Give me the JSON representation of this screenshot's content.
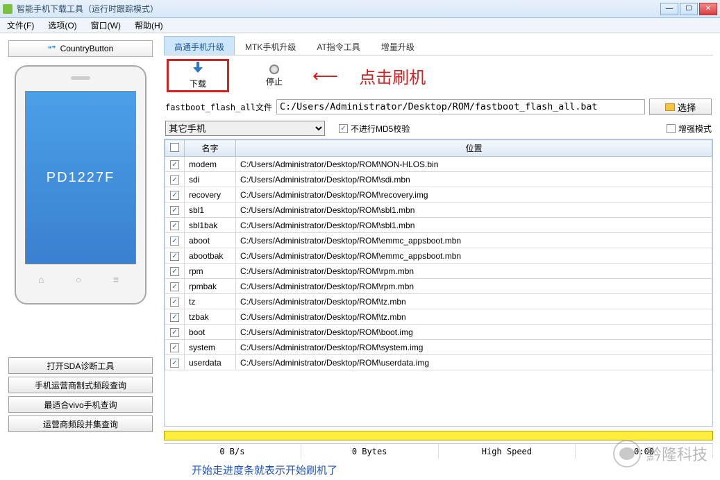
{
  "window": {
    "title": "智能手机下载工具（运行时跟踪模式）"
  },
  "menu": {
    "file": "文件(F)",
    "options": "选项(O)",
    "window": "窗口(W)",
    "help": "帮助(H)"
  },
  "sidebar": {
    "country_button": "CountryButton",
    "phone_model": "PD1227F",
    "buttons": {
      "sda": "打开SDA诊断工具",
      "carrier_band": "手机运营商制式频段查询",
      "vivo_query": "最适合vivo手机查询",
      "band_collect": "运营商频段并集查询"
    }
  },
  "tabs": {
    "qualcomm": "高通手机升级",
    "mtk": "MTK手机升级",
    "at": "AT指令工具",
    "incremental": "增量升级"
  },
  "toolbar": {
    "download": "下载",
    "stop": "停止"
  },
  "annotation": {
    "arrow": "⬅",
    "text": "点击刷机"
  },
  "file_row": {
    "label": "fastboot_flash_all文件",
    "path": "C:/Users/Administrator/Desktop/ROM/fastboot_flash_all.bat",
    "choose": "选择"
  },
  "opts": {
    "phone_type": "其它手机",
    "skip_md5": "不进行MD5校验",
    "enhanced": "增强模式"
  },
  "table": {
    "headers": {
      "name": "名字",
      "location": "位置"
    },
    "rows": [
      {
        "checked": true,
        "name": "modem",
        "location": "C:/Users/Administrator/Desktop/ROM\\NON-HLOS.bin"
      },
      {
        "checked": true,
        "name": "sdi",
        "location": "C:/Users/Administrator/Desktop/ROM\\sdi.mbn"
      },
      {
        "checked": true,
        "name": "recovery",
        "location": "C:/Users/Administrator/Desktop/ROM\\recovery.img"
      },
      {
        "checked": true,
        "name": "sbl1",
        "location": "C:/Users/Administrator/Desktop/ROM\\sbl1.mbn"
      },
      {
        "checked": true,
        "name": "sbl1bak",
        "location": "C:/Users/Administrator/Desktop/ROM\\sbl1.mbn"
      },
      {
        "checked": true,
        "name": "aboot",
        "location": "C:/Users/Administrator/Desktop/ROM\\emmc_appsboot.mbn"
      },
      {
        "checked": true,
        "name": "abootbak",
        "location": "C:/Users/Administrator/Desktop/ROM\\emmc_appsboot.mbn"
      },
      {
        "checked": true,
        "name": "rpm",
        "location": "C:/Users/Administrator/Desktop/ROM\\rpm.mbn"
      },
      {
        "checked": true,
        "name": "rpmbak",
        "location": "C:/Users/Administrator/Desktop/ROM\\rpm.mbn"
      },
      {
        "checked": true,
        "name": "tz",
        "location": "C:/Users/Administrator/Desktop/ROM\\tz.mbn"
      },
      {
        "checked": true,
        "name": "tzbak",
        "location": "C:/Users/Administrator/Desktop/ROM\\tz.mbn"
      },
      {
        "checked": true,
        "name": "boot",
        "location": "C:/Users/Administrator/Desktop/ROM\\boot.img"
      },
      {
        "checked": true,
        "name": "system",
        "location": "C:/Users/Administrator/Desktop/ROM\\system.img"
      },
      {
        "checked": true,
        "name": "userdata",
        "location": "C:/Users/Administrator/Desktop/ROM\\userdata.img"
      }
    ]
  },
  "status": {
    "rate": "0 B/s",
    "bytes": "0 Bytes",
    "speed": "High Speed",
    "time": "0:00"
  },
  "footer_note": "开始走进度条就表示开始刷机了",
  "watermark": "黔隆科技"
}
